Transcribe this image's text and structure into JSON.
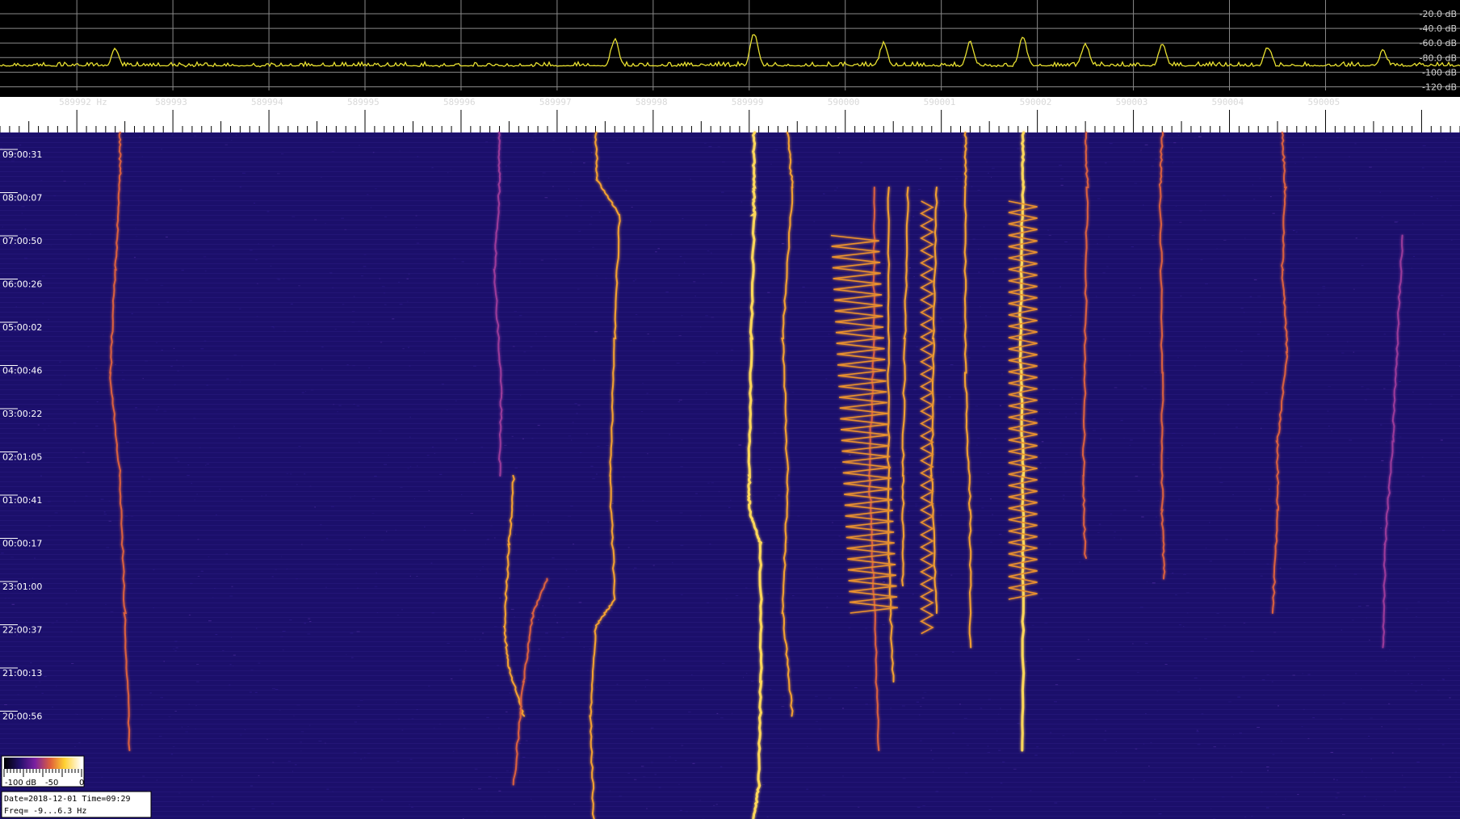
{
  "chart_data": {
    "type": "heatmap",
    "title": "",
    "spectrum": {
      "db_ticks": [
        "-20.0 dB",
        "-40.0 dB",
        "-60.0 dB",
        "-80.0 dB",
        "-100 dB",
        "-120 dB"
      ],
      "db_values": [
        -20,
        -40,
        -60,
        -80,
        -100,
        -120
      ],
      "ylim": [
        -125,
        -10
      ],
      "peaks": [
        {
          "freq": 589992.4,
          "db": -68
        },
        {
          "freq": 589997.6,
          "db": -55
        },
        {
          "freq": 589999.05,
          "db": -48
        },
        {
          "freq": 590000.4,
          "db": -60
        },
        {
          "freq": 590001.3,
          "db": -58
        },
        {
          "freq": 590001.85,
          "db": -52
        },
        {
          "freq": 590002.5,
          "db": -62
        },
        {
          "freq": 590003.3,
          "db": -62
        },
        {
          "freq": 590004.4,
          "db": -66
        },
        {
          "freq": 590005.6,
          "db": -70
        }
      ],
      "noise_floor_db": -93
    },
    "freq_axis": {
      "labels": [
        "589992 Hz",
        "589993",
        "589994",
        "589995",
        "589996",
        "589997",
        "589998",
        "589999",
        "590000",
        "590001",
        "590002",
        "590003",
        "590004",
        "590005"
      ],
      "values": [
        589992,
        589993,
        589994,
        589995,
        589996,
        589997,
        589998,
        589999,
        590000,
        590001,
        590002,
        590003,
        590004,
        590005
      ],
      "xlim": [
        589991.2,
        590006.4
      ]
    },
    "time_axis": {
      "labels": [
        "09:00:31",
        "08:00:07",
        "07:00:50",
        "06:00:26",
        "05:00:02",
        "04:00:46",
        "03:00:22",
        "02:01:05",
        "01:00:41",
        "00:00:17",
        "23:01:00",
        "22:00:37",
        "21:00:13",
        "20:00:56"
      ]
    },
    "traces": [
      {
        "points": [
          [
            589992.45,
            0
          ],
          [
            589992.45,
            0.07
          ],
          [
            589992.4,
            0.2
          ],
          [
            589992.35,
            0.35
          ],
          [
            589992.45,
            0.5
          ],
          [
            589992.5,
            0.7
          ],
          [
            589992.55,
            0.9
          ]
        ],
        "intensity": 0.6
      },
      {
        "points": [
          [
            589996.4,
            0
          ],
          [
            589996.4,
            0.08
          ],
          [
            589996.35,
            0.2
          ],
          [
            589996.42,
            0.38
          ],
          [
            589996.4,
            0.5
          ]
        ],
        "intensity": 0.45
      },
      {
        "points": [
          [
            589996.55,
            0.5
          ],
          [
            589996.5,
            0.6
          ],
          [
            589996.45,
            0.72
          ],
          [
            589996.5,
            0.78
          ],
          [
            589996.65,
            0.85
          ]
        ],
        "intensity": 0.9
      },
      {
        "points": [
          [
            589996.9,
            0.65
          ],
          [
            589996.75,
            0.7
          ],
          [
            589996.65,
            0.8
          ],
          [
            589996.55,
            0.95
          ]
        ],
        "intensity": 0.6
      },
      {
        "points": [
          [
            589997.4,
            0
          ],
          [
            589997.42,
            0.07
          ],
          [
            589997.65,
            0.12
          ],
          [
            589997.6,
            0.3
          ],
          [
            589997.55,
            0.5
          ],
          [
            589997.6,
            0.68
          ],
          [
            589997.4,
            0.72
          ],
          [
            589997.35,
            0.85
          ],
          [
            589997.38,
            1.0
          ]
        ],
        "intensity": 0.85
      },
      {
        "points": [
          [
            589999.05,
            0
          ],
          [
            589999.05,
            0.08
          ],
          [
            589999.05,
            0.12
          ],
          [
            589999.02,
            0.3
          ],
          [
            589999.0,
            0.5
          ],
          [
            589999.0,
            0.55
          ],
          [
            589999.12,
            0.6
          ],
          [
            589999.12,
            0.8
          ],
          [
            589999.1,
            0.95
          ],
          [
            589999.05,
            1.0
          ]
        ],
        "intensity": 1.0
      },
      {
        "points": [
          [
            589999.4,
            0
          ],
          [
            589999.45,
            0.08
          ],
          [
            589999.35,
            0.3
          ],
          [
            589999.4,
            0.5
          ],
          [
            589999.35,
            0.7
          ],
          [
            589999.45,
            0.85
          ]
        ],
        "intensity": 0.75
      },
      {
        "points": [
          [
            590000.3,
            0.08
          ],
          [
            590000.3,
            0.3
          ],
          [
            590000.25,
            0.5
          ],
          [
            590000.3,
            0.68
          ],
          [
            590000.35,
            0.9
          ]
        ],
        "intensity": 0.7
      },
      {
        "points": [
          [
            590000.45,
            0.08
          ],
          [
            590000.45,
            0.4
          ],
          [
            590000.45,
            0.62
          ],
          [
            590000.5,
            0.8
          ]
        ],
        "intensity": 0.8
      },
      {
        "points": [
          [
            590000.65,
            0.08
          ],
          [
            590000.62,
            0.3
          ],
          [
            590000.6,
            0.5
          ],
          [
            590000.6,
            0.66
          ]
        ],
        "intensity": 0.75
      },
      {
        "points": [
          [
            590000.95,
            0.08
          ],
          [
            590000.92,
            0.3
          ],
          [
            590000.9,
            0.5
          ],
          [
            590000.95,
            0.7
          ]
        ],
        "intensity": 0.75
      },
      {
        "points": [
          [
            590001.25,
            0
          ],
          [
            590001.25,
            0.08
          ],
          [
            590001.25,
            0.35
          ],
          [
            590001.3,
            0.55
          ],
          [
            590001.3,
            0.75
          ]
        ],
        "intensity": 0.8
      },
      {
        "points": [
          [
            590001.85,
            0
          ],
          [
            590001.85,
            0.08
          ],
          [
            590001.82,
            0.3
          ],
          [
            590001.85,
            0.5
          ],
          [
            590001.85,
            0.65
          ],
          [
            590001.85,
            0.9
          ]
        ],
        "intensity": 0.95
      },
      {
        "points": [
          [
            590002.5,
            0
          ],
          [
            590002.52,
            0.08
          ],
          [
            590002.5,
            0.3
          ],
          [
            590002.48,
            0.5
          ],
          [
            590002.5,
            0.62
          ]
        ],
        "intensity": 0.65
      },
      {
        "points": [
          [
            590003.3,
            0
          ],
          [
            590003.28,
            0.08
          ],
          [
            590003.3,
            0.35
          ],
          [
            590003.3,
            0.55
          ],
          [
            590003.32,
            0.65
          ]
        ],
        "intensity": 0.6
      },
      {
        "points": [
          [
            590004.55,
            0
          ],
          [
            590004.58,
            0.08
          ],
          [
            590004.55,
            0.2
          ],
          [
            590004.6,
            0.32
          ],
          [
            590004.5,
            0.45
          ],
          [
            590004.5,
            0.55
          ],
          [
            590004.45,
            0.7
          ]
        ],
        "intensity": 0.65
      },
      {
        "points": [
          [
            590005.8,
            0.15
          ],
          [
            590005.75,
            0.3
          ],
          [
            590005.7,
            0.45
          ],
          [
            590005.62,
            0.6
          ],
          [
            590005.6,
            0.75
          ]
        ],
        "intensity": 0.5
      }
    ],
    "zigzags": [
      {
        "center_start": 590000.1,
        "center_end": 590000.3,
        "amplitude": 0.25,
        "y_start": 0.15,
        "y_end": 0.7
      },
      {
        "center_start": 590001.85,
        "center_end": 590001.85,
        "amplitude": 0.15,
        "y_start": 0.1,
        "y_end": 0.68
      },
      {
        "center_start": 590000.85,
        "center_end": 590000.85,
        "amplitude": 0.06,
        "y_start": 0.1,
        "y_end": 0.73
      }
    ],
    "colorbar": {
      "labels": [
        "-100 dB",
        "-50",
        "0"
      ],
      "colors": [
        "#000000",
        "#22106a",
        "#7a1fa0",
        "#e0603a",
        "#ffd030",
        "#ffffff"
      ]
    }
  },
  "info": {
    "line1": "Date=2018-12-01 Time=09:29",
    "line2": "Freq= -9...6.3 Hz"
  }
}
